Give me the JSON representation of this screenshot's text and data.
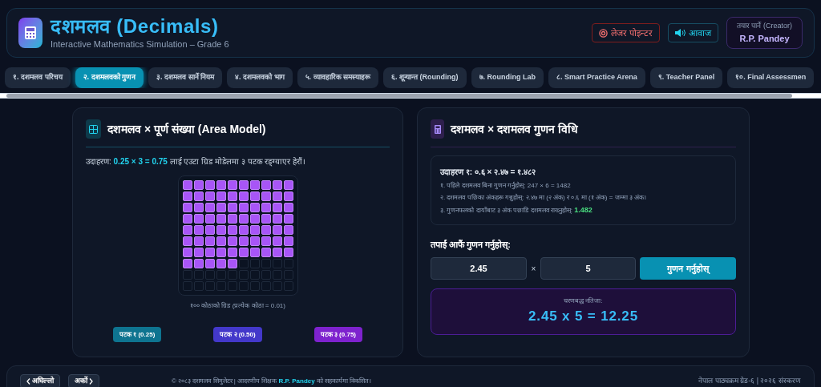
{
  "header": {
    "title": "दशमलव (Decimals)",
    "subtitle": "Interactive Mathematics Simulation – Grade 6",
    "laser_button": "लेजर पोइन्टर",
    "sound_button": "आवाज",
    "creator_label": "तयार पार्ने (Creator)",
    "creator_name": "R.P. Pandey"
  },
  "tabs": [
    {
      "label": "१. दशमलव परिचय",
      "selected": false
    },
    {
      "label": "२. दशमलवको गुणन",
      "selected": true
    },
    {
      "label": "३. दशमलव सार्ने नियम",
      "selected": false
    },
    {
      "label": "४. दशमलवको भाग",
      "selected": false
    },
    {
      "label": "५. व्यावहारिक समस्याहरू",
      "selected": false
    },
    {
      "label": "६. शून्यान्त (Rounding)",
      "selected": false
    },
    {
      "label": "७. Rounding Lab",
      "selected": false
    },
    {
      "label": "८. Smart Practice Arena",
      "selected": false
    },
    {
      "label": "९. Teacher Panel",
      "selected": false
    },
    {
      "label": "१०. Final Assessmen",
      "selected": false
    }
  ],
  "area_model": {
    "title": "दशमलव × पूर्ण संख्या (Area Model)",
    "example": "उदाहरण: **0.25 × 3 = 0.75** लाई एउटा ग्रिड मोडेलमा ३ पटक रङ्ग्याएर हेरौं।",
    "grid_caption": "१०० कोठाको ग्रिड (प्रत्येक कोठा = 0.01)",
    "steps": [
      {
        "label": "पटक १ (0.25)",
        "color": "#0e7490"
      },
      {
        "label": "पटक २ (0.50)",
        "color": "#4338ca"
      },
      {
        "label": "पटक ३ (0.75)",
        "color": "#7e22ce"
      }
    ]
  },
  "decimal_method": {
    "title": "दशमलव × दशमलव गुणन विधि",
    "example_title": "उदाहरण १: ०.६ × २.४७ = १.४८२",
    "steps": [
      "१. पहिले दशमलव बिना गुणन गर्नुहोस्: 247 × 6 = 1482",
      "२. दशमलव पछिका अंकहरू गन्नुहोस्: २.४७ मा (२ अंक) र ०.६ मा (१ अंक) = जम्मा ३ अंक।",
      "३. गुणनफलको दायाँबाट ३ अंक पछाडि दशमलव राख्नुहोस्: **1.482**"
    ],
    "try_label": "तपाईं आफैं गुणन गर्नुहोस्:",
    "input_a": "2.45",
    "times": "×",
    "input_b": "5",
    "button": "गुणन गर्नुहोस्",
    "result_label": "चरणबद्ध नतिजा:",
    "result": "2.45 x 5 = 12.25"
  },
  "footer": {
    "prev": "अघिल्लो",
    "next": "अर्को",
    "credit": "© २०८३ दशमलव सिमुलेटर | आदरणीय शिक्षक **R.P. Pandey** को सहकार्यमा विकसित।",
    "edition": "नेपाल पाठ्यक्रम ग्रेड-६ | २०२६ संस्करण"
  }
}
